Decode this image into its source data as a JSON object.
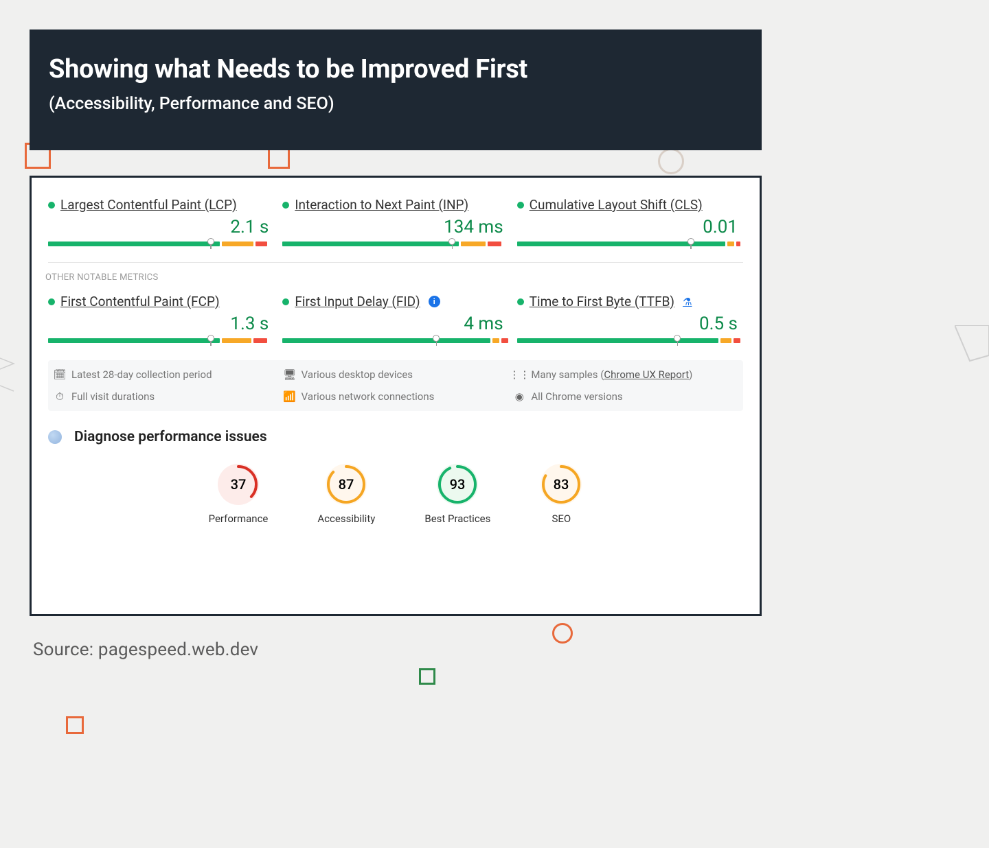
{
  "header": {
    "title": "Showing what Needs to be Improved First",
    "subtitle": "(Accessibility, Performance and SEO)"
  },
  "core_metrics": [
    {
      "name": "Largest Contentful Paint (LCP)",
      "value": "2.1 s",
      "green_pct": 76,
      "orange_pct": 14,
      "red_pct": 5,
      "marker_pct": 72
    },
    {
      "name": "Interaction to Next Paint (INP)",
      "value": "134 ms",
      "green_pct": 78,
      "orange_pct": 11,
      "red_pct": 6,
      "marker_pct": 75
    },
    {
      "name": "Cumulative Layout Shift (CLS)",
      "value": "0.01",
      "green_pct": 92,
      "orange_pct": 3,
      "red_pct": 2,
      "marker_pct": 77
    }
  ],
  "other_section_label": "OTHER NOTABLE METRICS",
  "other_metrics": [
    {
      "name": "First Contentful Paint (FCP)",
      "value": "1.3 s",
      "green_pct": 76,
      "orange_pct": 13,
      "red_pct": 6,
      "marker_pct": 72,
      "badge": ""
    },
    {
      "name": "First Input Delay (FID)",
      "value": "4 ms",
      "green_pct": 92,
      "orange_pct": 3,
      "red_pct": 3,
      "marker_pct": 68,
      "badge": "info"
    },
    {
      "name": "Time to First Byte (TTFB)",
      "value": "0.5 s",
      "green_pct": 89,
      "orange_pct": 5,
      "red_pct": 3,
      "marker_pct": 71,
      "badge": "flask"
    }
  ],
  "notes": {
    "period": "Latest 28-day collection period",
    "devices": "Various desktop devices",
    "samples_prefix": "Many samples (",
    "samples_link": "Chrome UX Report",
    "samples_suffix": ")",
    "durations": "Full visit durations",
    "network": "Various network connections",
    "versions": "All Chrome versions"
  },
  "diagnose": {
    "title": "Diagnose performance issues"
  },
  "scores": [
    {
      "label": "Performance",
      "value": "37",
      "color": "red",
      "stroke": "#d93025",
      "arc_pct": 37
    },
    {
      "label": "Accessibility",
      "value": "87",
      "color": "orange",
      "stroke": "#f5a623",
      "arc_pct": 87
    },
    {
      "label": "Best Practices",
      "value": "93",
      "color": "green",
      "stroke": "#17b36b",
      "arc_pct": 93
    },
    {
      "label": "SEO",
      "value": "83",
      "color": "orange",
      "stroke": "#f5a623",
      "arc_pct": 83
    }
  ],
  "source": "Source: pagespeed.web.dev"
}
